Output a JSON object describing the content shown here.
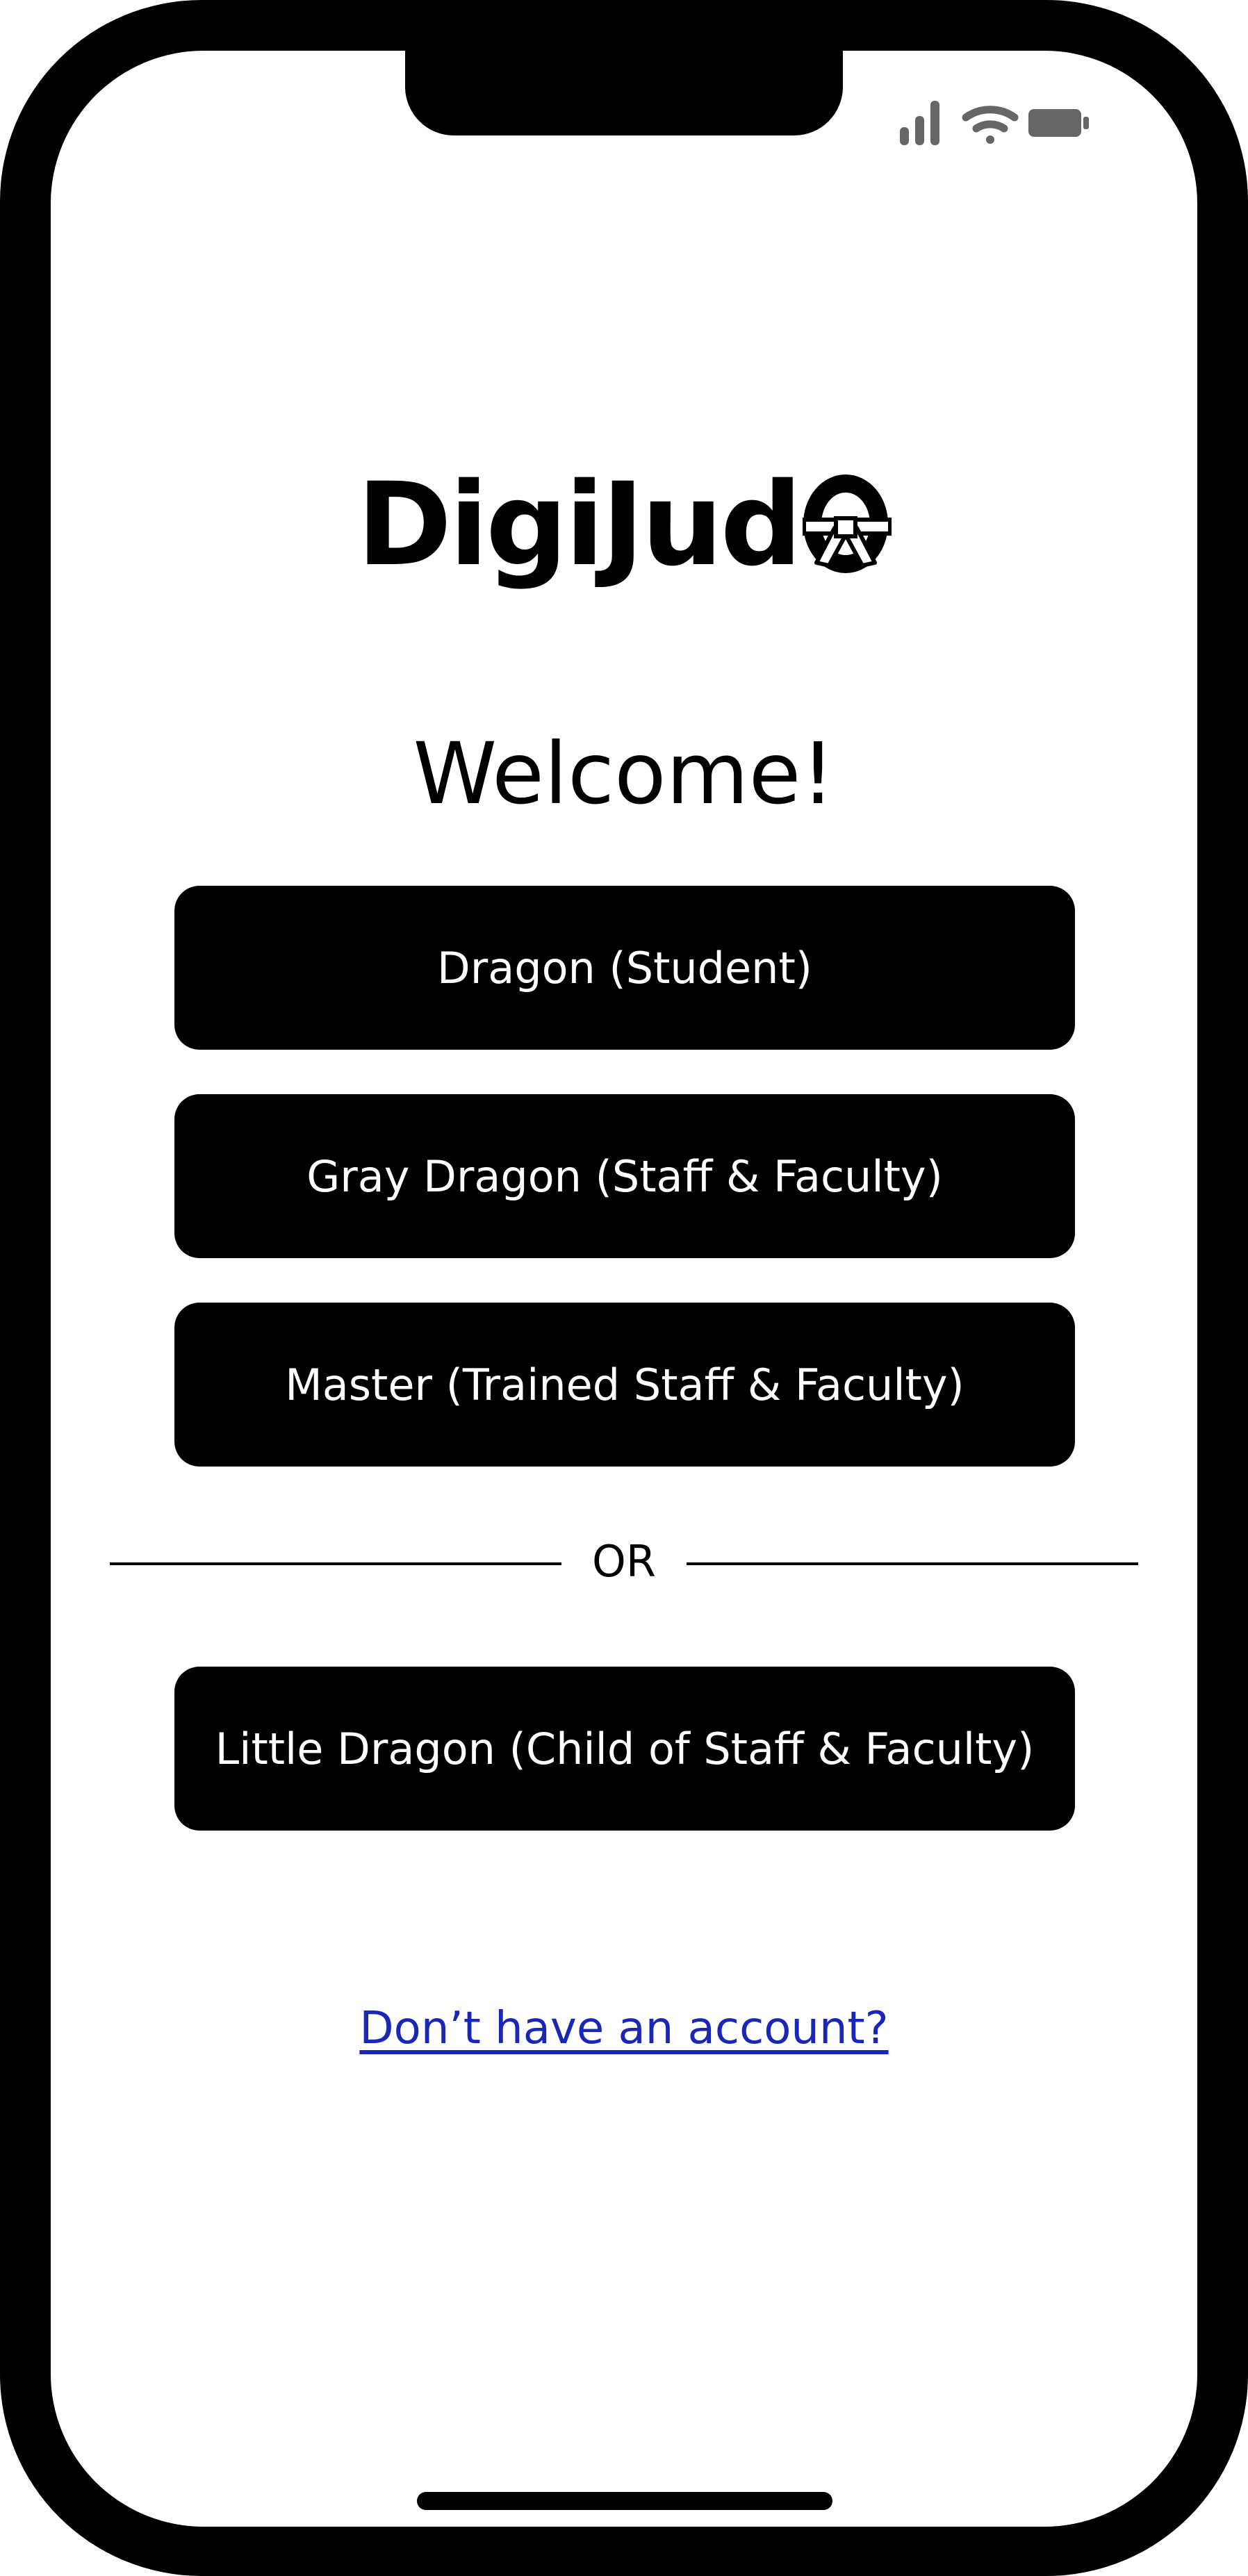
{
  "app": {
    "logo_text": "DigiJud",
    "logo_o_icon": "belt-o-icon"
  },
  "status_bar": {
    "icons": [
      "signal-icon",
      "wifi-icon",
      "battery-icon"
    ],
    "icon_color": "#666666"
  },
  "welcome": {
    "title": "Welcome!"
  },
  "roles": [
    {
      "label": "Dragon (Student)"
    },
    {
      "label": "Gray Dragon (Staff & Faculty)"
    },
    {
      "label": "Master (Trained Staff & Faculty)"
    }
  ],
  "divider": {
    "label": "OR"
  },
  "little_dragon": {
    "label": "Little Dragon (Child of Staff & Faculty)"
  },
  "signup": {
    "label": "Don’t have an account?",
    "color": "#1a26b5"
  },
  "colors": {
    "button_bg": "#000000",
    "button_text": "#ffffff",
    "background": "#ffffff"
  }
}
